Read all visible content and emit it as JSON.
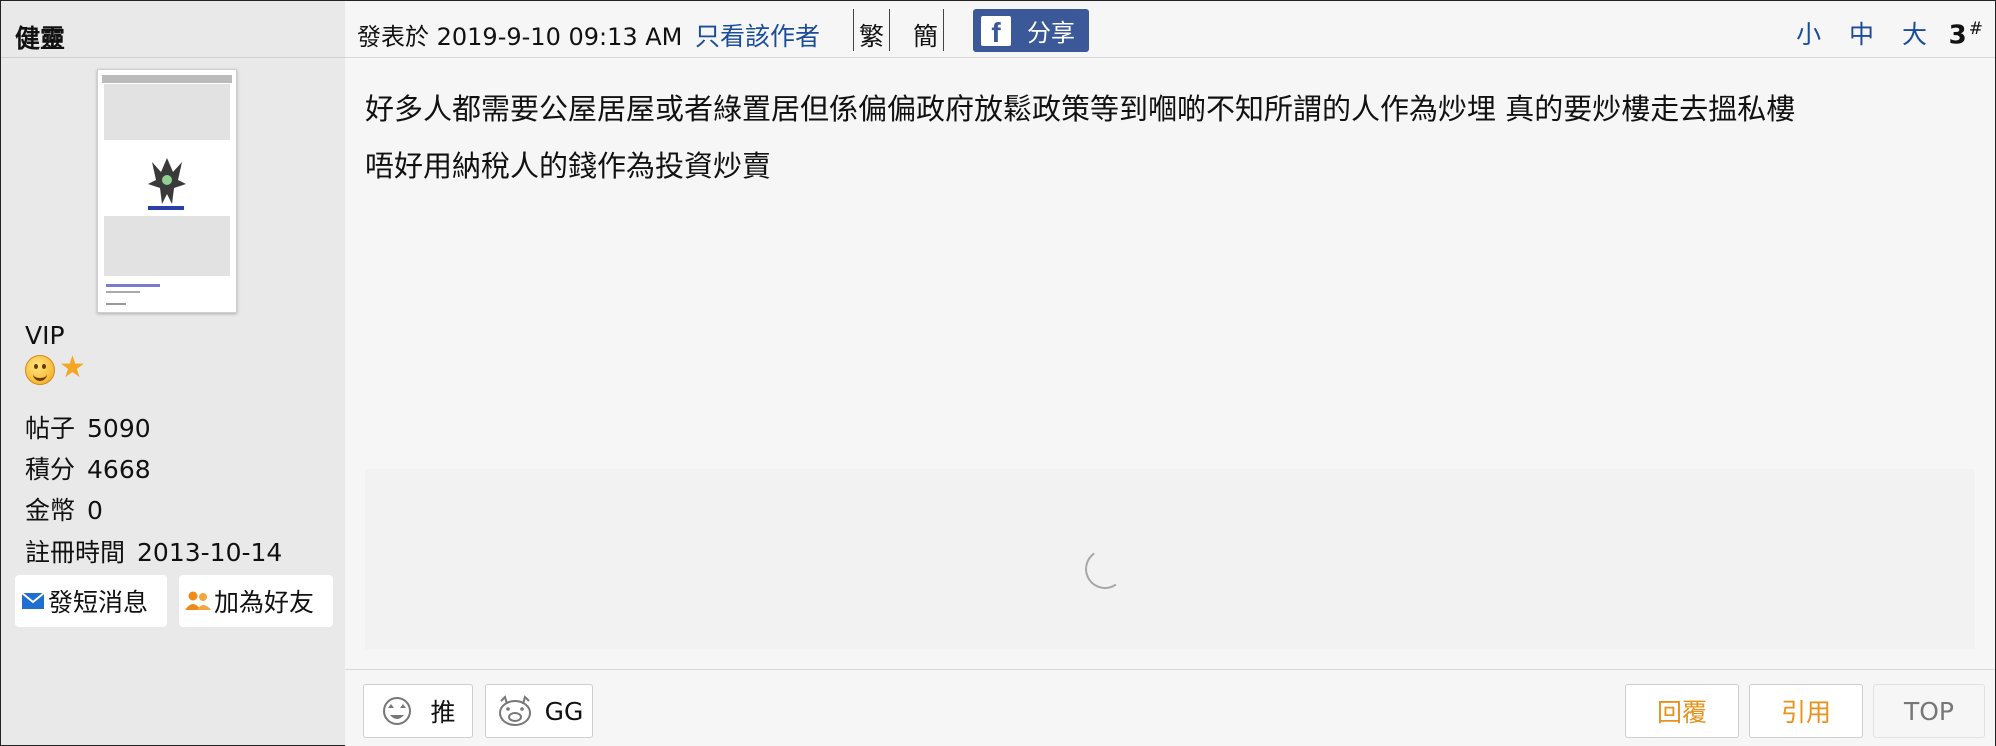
{
  "user": {
    "name": "健靈",
    "group": "VIP",
    "stats": [
      {
        "label": "帖子",
        "value": "5090"
      },
      {
        "label": "積分",
        "value": "4668"
      },
      {
        "label": "金幣",
        "value": "0"
      },
      {
        "label": "註冊時間",
        "value": "2013-10-14"
      }
    ],
    "pm_label": "發短消息",
    "add_friend_label": "加為好友"
  },
  "post": {
    "posted_label": "發表於 2019-9-10 09:13 AM",
    "only_author_label": "只看該作者",
    "traditional_label": "繁",
    "simplified_label": "簡",
    "share_label": "分享",
    "font_size_label": "小 中 大",
    "floor": "3",
    "floor_mark": "#",
    "content_lines": [
      "好多人都需要公屋居屋或者綠置居但係偏偏政府放鬆政策等到嗰啲不知所謂的人作為炒埋  真的要炒樓走去搵私樓",
      "唔好用納稅人的錢作為投資炒賣"
    ]
  },
  "actions": {
    "like_label": "推",
    "gg_label": "GG",
    "reply_label": "回覆",
    "quote_label": "引用",
    "top_label": "TOP"
  },
  "colors": {
    "link_blue": "#1b4c9a",
    "facebook_blue": "#3b5998",
    "action_orange": "#e8921b"
  }
}
